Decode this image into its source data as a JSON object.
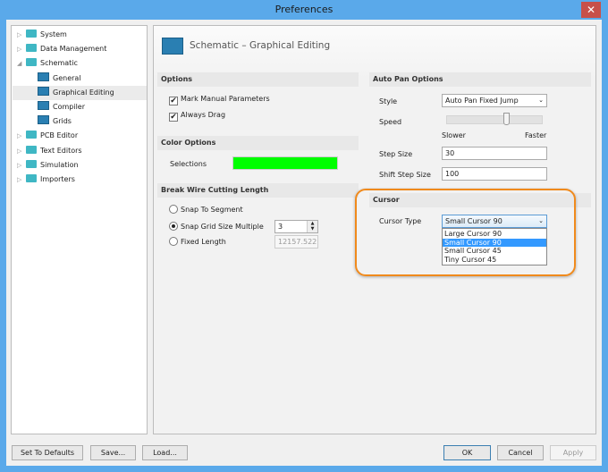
{
  "window": {
    "title": "Preferences",
    "close": "✕"
  },
  "tree": [
    {
      "label": "System",
      "type": "folder",
      "expander": "▷"
    },
    {
      "label": "Data Management",
      "type": "folder",
      "expander": "▷"
    },
    {
      "label": "Schematic",
      "type": "folder",
      "expander": "◢"
    },
    {
      "label": "General",
      "type": "page"
    },
    {
      "label": "Graphical Editing",
      "type": "page",
      "selected": true
    },
    {
      "label": "Compiler",
      "type": "page"
    },
    {
      "label": "Grids",
      "type": "page"
    },
    {
      "label": "PCB Editor",
      "type": "folder",
      "expander": "▷"
    },
    {
      "label": "Text Editors",
      "type": "folder",
      "expander": "▷"
    },
    {
      "label": "Simulation",
      "type": "folder",
      "expander": "▷"
    },
    {
      "label": "Importers",
      "type": "folder",
      "expander": "▷"
    }
  ],
  "page": {
    "title": "Schematic – Graphical Editing"
  },
  "options": {
    "header": "Options",
    "mark_manual": "Mark Manual Parameters",
    "always_drag": "Always Drag",
    "check": "✔"
  },
  "color_options": {
    "header": "Color Options",
    "selections": "Selections",
    "selection_color": "#00ff00"
  },
  "break_wire": {
    "header": "Break Wire Cutting Length",
    "snap_segment": "Snap To Segment",
    "snap_grid": "Snap Grid Size Multiple",
    "snap_grid_value": "3",
    "fixed_length": "Fixed Length",
    "fixed_length_value": "12157.522",
    "selected": "Snap Grid Size Multiple"
  },
  "auto_pan": {
    "header": "Auto Pan Options",
    "style_label": "Style",
    "style_value": "Auto Pan Fixed Jump",
    "speed_label": "Speed",
    "speed_level": 0.62,
    "slower": "Slower",
    "faster": "Faster",
    "step_label": "Step Size",
    "step_value": "30",
    "shift_label": "Shift Step Size",
    "shift_value": "100"
  },
  "cursor": {
    "header": "Cursor",
    "type_label": "Cursor Type",
    "type_value": "Small Cursor 90",
    "options": [
      "Large Cursor 90",
      "Small Cursor 90",
      "Small Cursor 45",
      "Tiny Cursor 45"
    ],
    "highlight_color": "#f08a1c"
  },
  "buttons": {
    "defaults": "Set To Defaults",
    "save": "Save...",
    "load": "Load...",
    "ok": "OK",
    "cancel": "Cancel",
    "apply": "Apply"
  }
}
